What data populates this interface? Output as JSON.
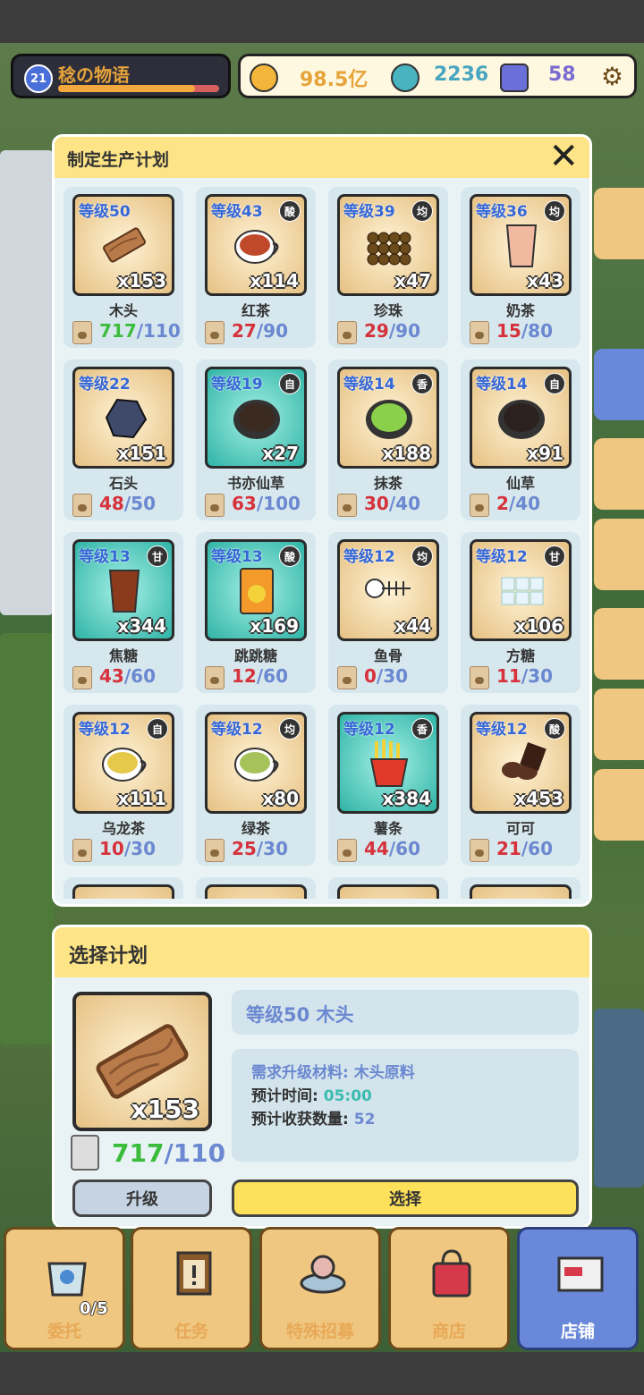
{
  "hud": {
    "level": "21",
    "shop_name": "稔の物语",
    "exp_fraction": 0.85,
    "gold": "98.5亿",
    "gems": "2236",
    "crystals": "58"
  },
  "plan_modal": {
    "title": "制定生产计划",
    "items": [
      {
        "level": "等级50",
        "tag": "",
        "qty": "x153",
        "name": "木头",
        "have": "717",
        "need": "/110",
        "enough": true,
        "bg": "gold",
        "color": "#b97a4a",
        "shape": "plank"
      },
      {
        "level": "等级43",
        "tag": "酸",
        "qty": "x114",
        "name": "红茶",
        "have": "27",
        "need": "/90",
        "enough": false,
        "bg": "gold",
        "color": "#c0492b",
        "shape": "cup"
      },
      {
        "level": "等级39",
        "tag": "均",
        "qty": "x47",
        "name": "珍珠",
        "have": "29",
        "need": "/90",
        "enough": false,
        "bg": "gold",
        "color": "#6b4a1b",
        "shape": "pearls"
      },
      {
        "level": "等级36",
        "tag": "均",
        "qty": "x43",
        "name": "奶茶",
        "have": "15",
        "need": "/80",
        "enough": false,
        "bg": "gold",
        "color": "#f1b9a0",
        "shape": "glass"
      },
      {
        "level": "等级22",
        "tag": "",
        "qty": "x151",
        "name": "石头",
        "have": "48",
        "need": "/50",
        "enough": false,
        "bg": "gold",
        "color": "#3f4a6b",
        "shape": "rock"
      },
      {
        "level": "等级19",
        "tag": "自",
        "qty": "x27",
        "name": "书亦仙草",
        "have": "63",
        "need": "/100",
        "enough": false,
        "bg": "teal",
        "color": "#3b2a20",
        "shape": "bowl"
      },
      {
        "level": "等级14",
        "tag": "香",
        "qty": "x188",
        "name": "抹茶",
        "have": "30",
        "need": "/40",
        "enough": false,
        "bg": "gold",
        "color": "#8ad04a",
        "shape": "bowl"
      },
      {
        "level": "等级14",
        "tag": "自",
        "qty": "x91",
        "name": "仙草",
        "have": "2",
        "need": "/40",
        "enough": false,
        "bg": "gold",
        "color": "#2b2220",
        "shape": "bowl"
      },
      {
        "level": "等级13",
        "tag": "甘",
        "qty": "x344",
        "name": "焦糖",
        "have": "43",
        "need": "/60",
        "enough": false,
        "bg": "teal",
        "color": "#8b3a1b",
        "shape": "glass"
      },
      {
        "level": "等级13",
        "tag": "酸",
        "qty": "x169",
        "name": "跳跳糖",
        "have": "12",
        "need": "/60",
        "enough": false,
        "bg": "teal",
        "color": "#f39a2a",
        "shape": "packet"
      },
      {
        "level": "等级12",
        "tag": "均",
        "qty": "x44",
        "name": "鱼骨",
        "have": "0",
        "need": "/30",
        "enough": false,
        "bg": "gold",
        "color": "#ffffff",
        "shape": "fish"
      },
      {
        "level": "等级12",
        "tag": "甘",
        "qty": "x106",
        "name": "方糖",
        "have": "11",
        "need": "/30",
        "enough": false,
        "bg": "gold",
        "color": "#e8f4fb",
        "shape": "cubes"
      },
      {
        "level": "等级12",
        "tag": "自",
        "qty": "x111",
        "name": "乌龙茶",
        "have": "10",
        "need": "/30",
        "enough": false,
        "bg": "gold",
        "color": "#e6c84a",
        "shape": "cup"
      },
      {
        "level": "等级12",
        "tag": "均",
        "qty": "x80",
        "name": "绿茶",
        "have": "25",
        "need": "/30",
        "enough": false,
        "bg": "gold",
        "color": "#a6c25a",
        "shape": "cup"
      },
      {
        "level": "等级12",
        "tag": "香",
        "qty": "x384",
        "name": "薯条",
        "have": "44",
        "need": "/60",
        "enough": false,
        "bg": "teal",
        "color": "#e23a2a",
        "shape": "fries"
      },
      {
        "level": "等级12",
        "tag": "酸",
        "qty": "x453",
        "name": "可可",
        "have": "21",
        "need": "/60",
        "enough": false,
        "bg": "gold",
        "color": "#5a3322",
        "shape": "choco"
      }
    ]
  },
  "select_modal": {
    "title": "选择计划",
    "qty": "x153",
    "have": "717",
    "need": "/110",
    "plan_name": "等级50 木头",
    "req_label": "需求升级材料:",
    "req_value": "木头原料",
    "time_label": "预计时间:",
    "time_value": "05:00",
    "yield_label": "预计收获数量:",
    "yield_value": "52",
    "upgrade_button": "升级",
    "select_button": "选择"
  },
  "bottom_nav": {
    "items": [
      {
        "label": "委托",
        "count": "0/5"
      },
      {
        "label": "任务",
        "count": ""
      },
      {
        "label": "特殊招募",
        "count": ""
      },
      {
        "label": "商店",
        "count": ""
      },
      {
        "label": "店铺",
        "count": ""
      }
    ]
  }
}
